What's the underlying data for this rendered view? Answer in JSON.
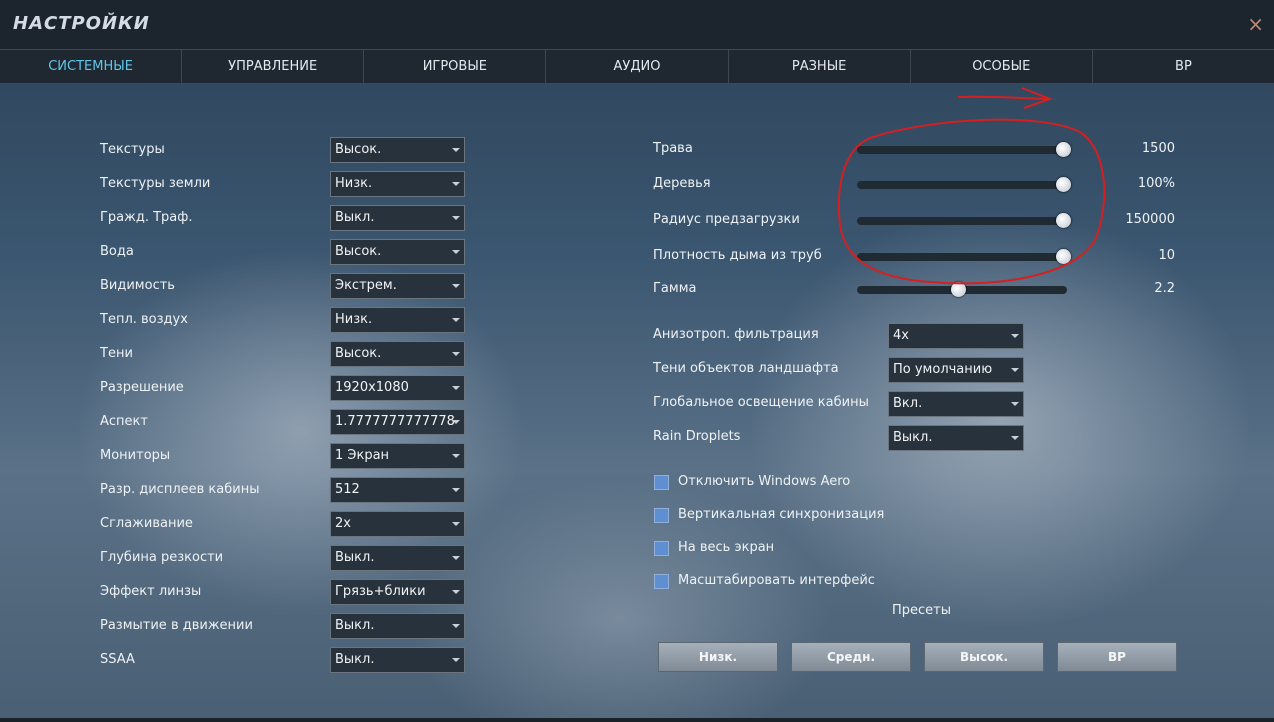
{
  "window": {
    "title": "НАСТРОЙКИ",
    "close_symbol": "×"
  },
  "tabs": [
    "СИСТЕМНЫЕ",
    "УПРАВЛЕНИЕ",
    "ИГРОВЫЕ",
    "АУДИО",
    "РАЗНЫЕ",
    "ОСОБЫЕ",
    "ВР"
  ],
  "active_tab": "СИСТЕМНЫЕ",
  "left_settings": [
    {
      "label": "Текстуры",
      "value": "Высок."
    },
    {
      "label": "Текстуры земли",
      "value": "Низк."
    },
    {
      "label": "Гражд. Траф.",
      "value": "Выкл."
    },
    {
      "label": "Вода",
      "value": "Высок."
    },
    {
      "label": "Видимость",
      "value": "Экстрем."
    },
    {
      "label": "Тепл. воздух",
      "value": "Низк."
    },
    {
      "label": "Тени",
      "value": "Высок."
    },
    {
      "label": "Разрешение",
      "value": "1920x1080"
    },
    {
      "label": "Аспект",
      "value": "1.7777777777778"
    },
    {
      "label": "Мониторы",
      "value": "1 Экран"
    },
    {
      "label": "Разр. дисплеев кабины",
      "value": "512"
    },
    {
      "label": "Сглаживание",
      "value": "2x"
    },
    {
      "label": "Глубина резкости",
      "value": "Выкл."
    },
    {
      "label": "Эффект линзы",
      "value": "Грязь+блики"
    },
    {
      "label": "Размытие в движении",
      "value": "Выкл."
    },
    {
      "label": "SSAA",
      "value": "Выкл."
    }
  ],
  "sliders": [
    {
      "label": "Трава",
      "value": "1500",
      "fraction": 0.98
    },
    {
      "label": "Деревья",
      "value": "100%",
      "fraction": 0.98
    },
    {
      "label": "Радиус предзагрузки",
      "value": "150000",
      "fraction": 0.98
    },
    {
      "label": "Плотность дыма из труб",
      "value": "10",
      "fraction": 0.98
    },
    {
      "label": "Гамма",
      "value": "2.2",
      "fraction": 0.48
    }
  ],
  "right_settings": [
    {
      "label": "Анизотроп. фильтрация",
      "value": "4x"
    },
    {
      "label": "Тени объектов ландшафта",
      "value": "По умолчанию"
    },
    {
      "label": "Глобальное освещение кабины",
      "value": "Вкл."
    },
    {
      "label": "Rain Droplets",
      "value": "Выкл."
    }
  ],
  "checkboxes": [
    {
      "label": "Отключить Windows Aero",
      "checked": false
    },
    {
      "label": "Вертикальная синхронизация",
      "checked": false
    },
    {
      "label": "На весь экран",
      "checked": false
    },
    {
      "label": "Масштабировать интерфейс",
      "checked": false
    }
  ],
  "presets": {
    "label": "Пресеты",
    "buttons": [
      "Низк.",
      "Средн.",
      "Высок.",
      "ВР"
    ]
  },
  "colors": {
    "active_tab": "#5fc6ea",
    "annotation": "#d42020",
    "checkbox": "#5f8fd0"
  }
}
